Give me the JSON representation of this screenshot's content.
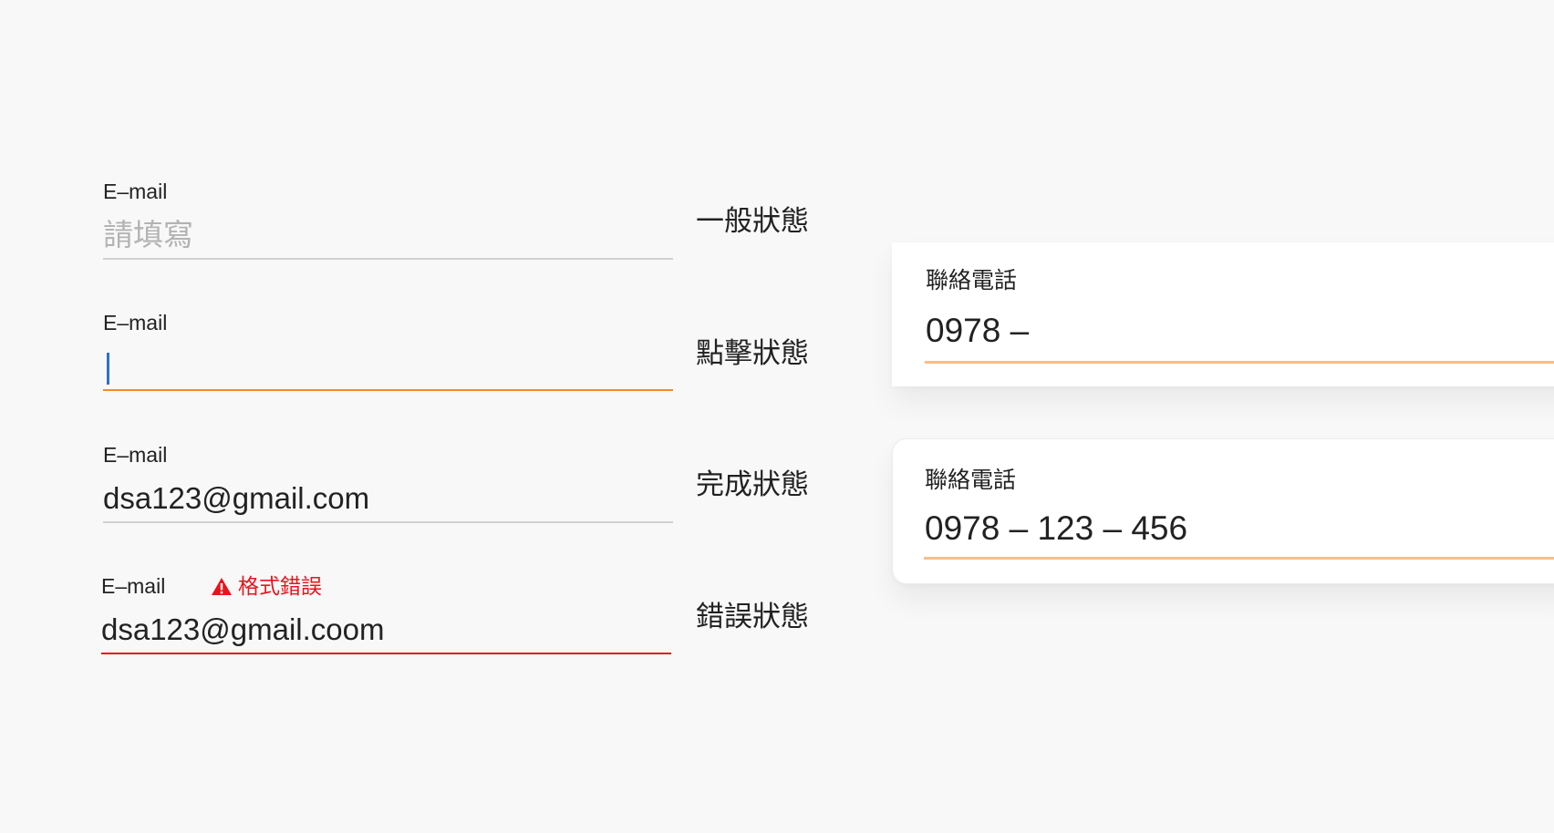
{
  "email_fields": [
    {
      "label": "E–mail",
      "value": "請填寫",
      "state_label": "一般狀態"
    },
    {
      "label": "E–mail",
      "value": "",
      "state_label": "點擊狀態"
    },
    {
      "label": "E–mail",
      "value": "dsa123@gmail.com",
      "state_label": "完成狀態"
    },
    {
      "label": "E–mail",
      "value": "dsa123@gmail.coom",
      "error_text": "格式錯誤",
      "state_label": "錯誤狀態"
    }
  ],
  "phone_cards": [
    {
      "label": "聯絡電話",
      "value": "0978 –"
    },
    {
      "label": "聯絡電話",
      "value": "0978 – 123 – 456"
    }
  ],
  "icons": {
    "cursor": "text-cursor",
    "warning": "warning-triangle-icon"
  },
  "colors": {
    "background": "#f8f8f8",
    "underline_default": "#d0d0d0",
    "underline_focus": "#f28a2e",
    "underline_error": "#e8141c",
    "underline_phone": "#fbbd87",
    "cursor": "#2c6fd1",
    "placeholder": "#b3b3b3",
    "text": "#222222",
    "error": "#e8141c"
  }
}
